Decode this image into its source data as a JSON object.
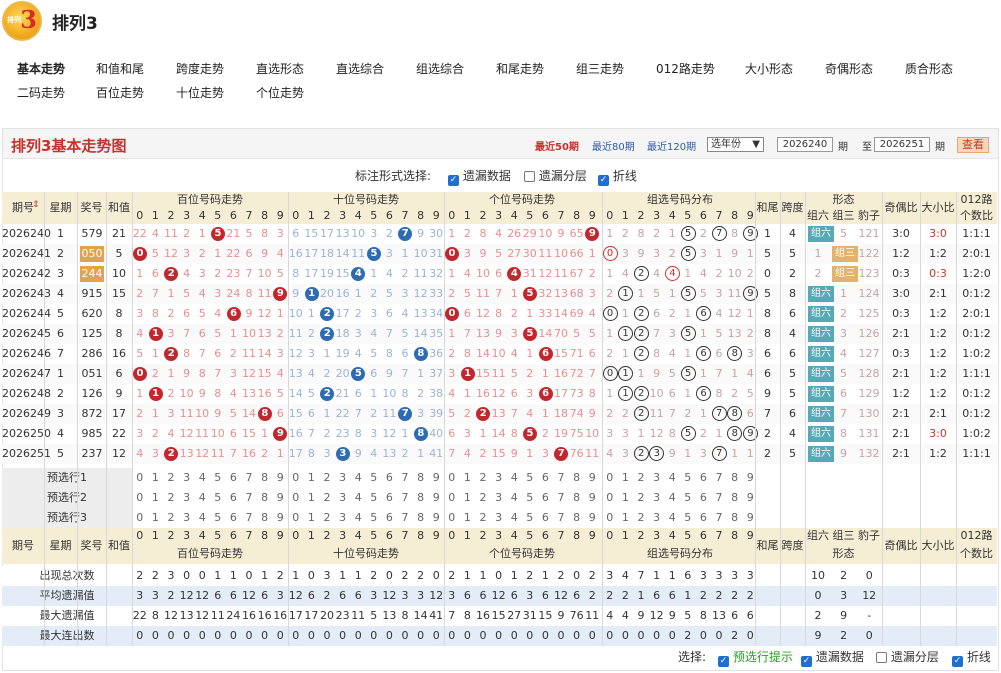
{
  "app": {
    "title": "排列3",
    "logo_small": "排列",
    "logo_num": "3"
  },
  "nav": [
    [
      "基本走势",
      17,
      60
    ],
    [
      "和值和尾",
      96,
      60
    ],
    [
      "跨度走势",
      176,
      60
    ],
    [
      "直选形态",
      256,
      60
    ],
    [
      "直选综合",
      336,
      60
    ],
    [
      "组选综合",
      416,
      60
    ],
    [
      "和尾走势",
      496,
      60
    ],
    [
      "组三走势",
      576,
      60
    ],
    [
      "012路走势",
      656,
      60
    ],
    [
      "大小形态",
      745,
      60
    ],
    [
      "奇偶形态",
      825,
      60
    ],
    [
      "质合形态",
      905,
      60
    ],
    [
      "二码走势",
      17,
      84
    ],
    [
      "百位走势",
      96,
      84
    ],
    [
      "十位走势",
      176,
      84
    ],
    [
      "个位走势",
      256,
      84
    ]
  ],
  "panel": {
    "title": "排列3基本走势图",
    "recent50": "最近50期",
    "recent80": "最近80期",
    "recent120": "最近120期",
    "year": "选年份",
    "from": "2026240",
    "to": "2026251",
    "qi": "期",
    "zhi": "至",
    "search": "查看"
  },
  "opts": {
    "label": "标注形式选择:",
    "a": "遗漏数据",
    "b": "遗漏分层",
    "c": "折线"
  },
  "head": {
    "qh": "期号",
    "xq": "星期",
    "jh": "奖号",
    "hz": "和值",
    "bai": "百位号码走势",
    "shi": "十位号码走势",
    "ge": "个位号码走势",
    "zx": "组选号码分布",
    "hw": "和尾",
    "kd": "跨度",
    "xt": "形态",
    "z6": "组六",
    "z3": "组三",
    "bz": "豹子",
    "jo": "奇偶比",
    "dx": "大小比",
    "l012": "012路",
    "gsb": "个数比"
  },
  "digits": [
    "0",
    "1",
    "2",
    "3",
    "4",
    "5",
    "6",
    "7",
    "8",
    "9"
  ],
  "rows": [
    {
      "qh": "2026240",
      "xq": "1",
      "jh": "579",
      "hz": "21",
      "b": [
        22,
        4,
        11,
        2,
        1,
        "5",
        21,
        5,
        8,
        3
      ],
      "s": [
        6,
        15,
        17,
        13,
        10,
        3,
        2,
        "7",
        9,
        30
      ],
      "g": [
        1,
        2,
        8,
        4,
        26,
        29,
        10,
        9,
        65,
        "9"
      ],
      "z": [
        "1",
        "2",
        "8",
        "2",
        "1",
        "5r",
        "2",
        "7r",
        "8",
        "9r"
      ],
      "hw": "1",
      "kd": "4",
      "xt": "z6",
      "xtv": [
        "组六",
        "5",
        "121"
      ],
      "jo": "3:0",
      "dx": "3:0",
      "l": "1:1:1"
    },
    {
      "qh": "2026241",
      "xq": "2",
      "jh": "050",
      "hl": true,
      "hz": "5",
      "b": [
        "0",
        5,
        12,
        3,
        2,
        1,
        22,
        6,
        9,
        4
      ],
      "s": [
        16,
        17,
        18,
        14,
        11,
        "5",
        3,
        1,
        10,
        31
      ],
      "g": [
        "0",
        3,
        9,
        5,
        27,
        30,
        11,
        10,
        66,
        1
      ],
      "z": [
        "0c",
        "3",
        "9",
        "3",
        "2",
        "5r",
        "3",
        "1",
        "9",
        "1"
      ],
      "hw": "5",
      "kd": "5",
      "xt": "z3",
      "xtv": [
        "1",
        "组三",
        "122"
      ],
      "jo": "1:2",
      "dx": "1:2",
      "l": "2:0:1"
    },
    {
      "qh": "2026242",
      "xq": "3",
      "jh": "244",
      "hl": true,
      "hz": "10",
      "b": [
        1,
        6,
        "2",
        4,
        3,
        2,
        23,
        7,
        10,
        5
      ],
      "s": [
        8,
        17,
        19,
        15,
        "4",
        1,
        4,
        2,
        11,
        32
      ],
      "g": [
        1,
        4,
        10,
        6,
        "4",
        31,
        12,
        11,
        67,
        2
      ],
      "z": [
        "1",
        "4",
        "2r",
        "4",
        "4c",
        "1",
        "4",
        "2",
        "10",
        "2"
      ],
      "hw": "0",
      "kd": "2",
      "xt": "z3",
      "xtv": [
        "2",
        "组三",
        "123"
      ],
      "jo": "0:3",
      "dx": "0:3",
      "l": "1:2:0"
    },
    {
      "qh": "2026243",
      "xq": "4",
      "jh": "915",
      "hz": "15",
      "b": [
        2,
        7,
        1,
        5,
        4,
        3,
        24,
        8,
        11,
        "9"
      ],
      "s": [
        9,
        "1",
        20,
        16,
        1,
        2,
        5,
        3,
        12,
        33
      ],
      "g": [
        2,
        5,
        11,
        7,
        1,
        "5",
        32,
        13,
        68,
        3
      ],
      "z": [
        "2",
        "1r",
        "1",
        "5",
        "1",
        "5r",
        "5",
        "3",
        "11",
        "9r"
      ],
      "hw": "5",
      "kd": "8",
      "xt": "z6",
      "xtv": [
        "组六",
        "1",
        "124"
      ],
      "jo": "3:0",
      "dx": "2:1",
      "l": "0:1:2"
    },
    {
      "qh": "2026244",
      "xq": "5",
      "jh": "620",
      "hz": "8",
      "b": [
        3,
        8,
        2,
        6,
        5,
        4,
        "6",
        9,
        12,
        1
      ],
      "s": [
        10,
        1,
        "2",
        17,
        2,
        3,
        6,
        4,
        13,
        34
      ],
      "g": [
        "0",
        6,
        12,
        8,
        2,
        1,
        33,
        14,
        69,
        4
      ],
      "z": [
        "0r",
        "1",
        "2r",
        "6",
        "2",
        "1",
        "6r",
        "4",
        "12",
        "1"
      ],
      "hw": "8",
      "kd": "6",
      "xt": "z6",
      "xtv": [
        "组六",
        "2",
        "125"
      ],
      "jo": "0:3",
      "dx": "1:2",
      "l": "2:0:1"
    },
    {
      "qh": "2026245",
      "xq": "6",
      "jh": "125",
      "hz": "8",
      "b": [
        4,
        "1",
        3,
        7,
        6,
        5,
        1,
        10,
        13,
        2
      ],
      "s": [
        11,
        2,
        "2",
        18,
        3,
        4,
        7,
        5,
        14,
        35
      ],
      "g": [
        1,
        7,
        13,
        9,
        3,
        "5",
        14,
        70,
        5,
        5
      ],
      "z": [
        "1",
        "1r",
        "2r",
        "7",
        "3",
        "5r",
        "1",
        "5",
        "13",
        "2"
      ],
      "hw": "8",
      "kd": "4",
      "xt": "z6",
      "xtv": [
        "组六",
        "3",
        "126"
      ],
      "jo": "2:1",
      "dx": "1:2",
      "l": "0:1:2"
    },
    {
      "qh": "2026246",
      "xq": "7",
      "jh": "286",
      "hz": "16",
      "b": [
        5,
        1,
        "2",
        8,
        7,
        6,
        2,
        11,
        14,
        3
      ],
      "s": [
        12,
        3,
        1,
        19,
        4,
        5,
        8,
        6,
        "8",
        36
      ],
      "g": [
        2,
        8,
        14,
        10,
        4,
        1,
        "6",
        15,
        71,
        6
      ],
      "z": [
        "2",
        "1",
        "2r",
        "8",
        "4",
        "1",
        "6r",
        "6",
        "8r",
        "3"
      ],
      "hw": "6",
      "kd": "6",
      "xt": "z6",
      "xtv": [
        "组六",
        "4",
        "127"
      ],
      "jo": "0:3",
      "dx": "1:2",
      "l": "1:0:2"
    },
    {
      "qh": "2026247",
      "xq": "1",
      "jh": "051",
      "hz": "6",
      "b": [
        "0",
        2,
        1,
        9,
        8,
        7,
        3,
        12,
        15,
        4
      ],
      "s": [
        13,
        4,
        2,
        20,
        "5",
        6,
        9,
        7,
        1,
        37
      ],
      "g": [
        3,
        "1",
        15,
        11,
        5,
        2,
        1,
        16,
        72,
        7
      ],
      "z": [
        "0r",
        "1r",
        "1",
        "9",
        "5",
        "5r",
        "1",
        "7",
        "1",
        "4"
      ],
      "hw": "6",
      "kd": "5",
      "xt": "z6",
      "xtv": [
        "组六",
        "5",
        "128"
      ],
      "jo": "2:1",
      "dx": "1:2",
      "l": "1:1:1"
    },
    {
      "qh": "2026248",
      "xq": "2",
      "jh": "126",
      "hz": "9",
      "b": [
        1,
        "1",
        2,
        10,
        9,
        8,
        4,
        13,
        16,
        5
      ],
      "s": [
        14,
        5,
        "2",
        21,
        6,
        1,
        10,
        8,
        2,
        38
      ],
      "g": [
        4,
        1,
        16,
        12,
        6,
        3,
        "6",
        17,
        73,
        8
      ],
      "z": [
        "1",
        "1r",
        "2r",
        "10",
        "6",
        "1",
        "6r",
        "8",
        "2",
        "5"
      ],
      "hw": "9",
      "kd": "5",
      "xt": "z6",
      "xtv": [
        "组六",
        "6",
        "129"
      ],
      "jo": "1:2",
      "dx": "1:2",
      "l": "0:1:2"
    },
    {
      "qh": "2026249",
      "xq": "3",
      "jh": "872",
      "hz": "17",
      "b": [
        2,
        1,
        3,
        11,
        10,
        9,
        5,
        14,
        "8",
        6
      ],
      "s": [
        15,
        6,
        1,
        22,
        7,
        2,
        11,
        "7",
        3,
        39
      ],
      "g": [
        5,
        2,
        "2",
        13,
        7,
        4,
        1,
        18,
        74,
        9
      ],
      "z": [
        "2",
        "2",
        "2r",
        "11",
        "7",
        "2",
        "1",
        "7r",
        "8r",
        "6"
      ],
      "hw": "7",
      "kd": "6",
      "xt": "z6",
      "xtv": [
        "组六",
        "7",
        "130"
      ],
      "jo": "2:1",
      "dx": "2:1",
      "l": "0:1:2"
    },
    {
      "qh": "2026250",
      "xq": "4",
      "jh": "985",
      "hz": "22",
      "b": [
        3,
        2,
        4,
        12,
        11,
        10,
        6,
        15,
        1,
        "9"
      ],
      "s": [
        16,
        7,
        2,
        23,
        8,
        3,
        12,
        1,
        "8",
        40
      ],
      "g": [
        6,
        3,
        1,
        14,
        8,
        "5",
        2,
        19,
        75,
        10
      ],
      "z": [
        "3",
        "3",
        "1",
        "12",
        "8",
        "5r",
        "2",
        "1",
        "8r",
        "9r"
      ],
      "hw": "2",
      "kd": "4",
      "xt": "z6",
      "xtv": [
        "组六",
        "8",
        "131"
      ],
      "jo": "2:1",
      "dx": "3:0",
      "l": "1:0:2"
    },
    {
      "qh": "2026251",
      "xq": "5",
      "jh": "237",
      "hz": "12",
      "b": [
        4,
        3,
        "2",
        13,
        12,
        11,
        7,
        16,
        2,
        1
      ],
      "s": [
        17,
        8,
        3,
        "3",
        9,
        4,
        13,
        2,
        1,
        41
      ],
      "g": [
        7,
        4,
        2,
        15,
        9,
        1,
        3,
        "7",
        76,
        11
      ],
      "z": [
        "4",
        "3",
        "2r",
        "3r",
        "9",
        "1",
        "3",
        "7r",
        "1",
        "1"
      ],
      "hw": "2",
      "kd": "5",
      "xt": "z6",
      "xtv": [
        "组六",
        "9",
        "132"
      ],
      "jo": "2:1",
      "dx": "1:2",
      "l": "1:1:1"
    }
  ],
  "yx": [
    "预选行1",
    "预选行2",
    "预选行3"
  ],
  "stats": [
    {
      "n": "出现总次数",
      "b": [
        "2",
        "2",
        "3",
        "0",
        "0",
        "1",
        "1",
        "0",
        "1",
        "2"
      ],
      "s": [
        "1",
        "0",
        "3",
        "1",
        "1",
        "2",
        "0",
        "2",
        "2",
        "0"
      ],
      "g": [
        "2",
        "1",
        "1",
        "0",
        "1",
        "2",
        "1",
        "2",
        "0",
        "2"
      ],
      "z": [
        "3",
        "4",
        "7",
        "1",
        "1",
        "6",
        "3",
        "3",
        "3",
        "3"
      ],
      "xt": [
        "10",
        "2",
        "0"
      ]
    },
    {
      "n": "平均遗漏值",
      "b": [
        "3",
        "3",
        "2",
        "12",
        "12",
        "6",
        "6",
        "12",
        "6",
        "3"
      ],
      "s": [
        "12",
        "6",
        "2",
        "6",
        "6",
        "3",
        "12",
        "3",
        "3",
        "12"
      ],
      "g": [
        "3",
        "6",
        "6",
        "12",
        "6",
        "3",
        "6",
        "12",
        "6",
        "2"
      ],
      "z": [
        "2",
        "2",
        "1",
        "6",
        "6",
        "1",
        "2",
        "2",
        "2",
        "2"
      ],
      "xt": [
        "0",
        "3",
        "12"
      ]
    },
    {
      "n": "最大遗漏值",
      "b": [
        "22",
        "8",
        "12",
        "13",
        "12",
        "11",
        "24",
        "16",
        "16",
        "16"
      ],
      "s": [
        "17",
        "17",
        "20",
        "23",
        "11",
        "5",
        "13",
        "8",
        "14",
        "41"
      ],
      "g": [
        "7",
        "8",
        "16",
        "15",
        "27",
        "31",
        "15",
        "9",
        "76",
        "11"
      ],
      "z": [
        "4",
        "4",
        "9",
        "12",
        "9",
        "5",
        "8",
        "13",
        "6",
        "6"
      ],
      "xt": [
        "2",
        "9",
        "-"
      ]
    },
    {
      "n": "最大连出数",
      "b": [
        "0",
        "0",
        "0",
        "0",
        "0",
        "0",
        "0",
        "0",
        "0",
        "0"
      ],
      "s": [
        "0",
        "0",
        "0",
        "0",
        "0",
        "0",
        "0",
        "0",
        "0",
        "0"
      ],
      "g": [
        "0",
        "0",
        "0",
        "0",
        "0",
        "0",
        "0",
        "0",
        "0",
        "0"
      ],
      "z": [
        "0",
        "0",
        "0",
        "0",
        "0",
        "2",
        "0",
        "0",
        "2",
        "0"
      ],
      "xt": [
        "9",
        "2",
        "0"
      ]
    }
  ],
  "footer": {
    "label": "选择:",
    "a": "预选行提示",
    "b": "遗漏数据",
    "c": "遗漏分层",
    "d": "折线"
  }
}
